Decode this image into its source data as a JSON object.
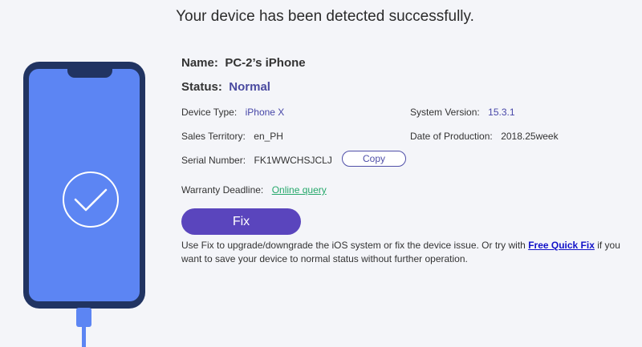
{
  "headline": "Your device has been detected successfully.",
  "device": {
    "name_label": "Name:",
    "name_value": "PC-2’s iPhone",
    "status_label": "Status:",
    "status_value": "Normal",
    "device_type_label": "Device Type:",
    "device_type_value": "iPhone X",
    "system_version_label": "System Version:",
    "system_version_value": "15.3.1",
    "sales_territory_label": "Sales Territory:",
    "sales_territory_value": "en_PH",
    "date_of_production_label": "Date of Production:",
    "date_of_production_value": "2018.25week",
    "serial_number_label": "Serial Number:",
    "serial_number_value": "FK1WWCHSJCLJ",
    "copy_label": "Copy",
    "warranty_label": "Warranty Deadline:",
    "warranty_link": "Online query"
  },
  "actions": {
    "fix_label": "Fix",
    "description_before": "Use Fix to upgrade/downgrade the iOS system or fix the device issue. Or try with ",
    "free_quick_fix_label": "Free Quick Fix",
    "description_after": " if you want to save your device to normal status without further operation."
  },
  "colors": {
    "phone_frame": "#213462",
    "phone_screen": "#5c85f3",
    "fix_button": "#5a45bd",
    "status_text": "#4a4aa0",
    "link_green": "#25a86b",
    "link_blue": "#1212c9"
  },
  "icons": {
    "phone": "phone-illustration-icon",
    "check": "checkmark-circle-icon"
  }
}
